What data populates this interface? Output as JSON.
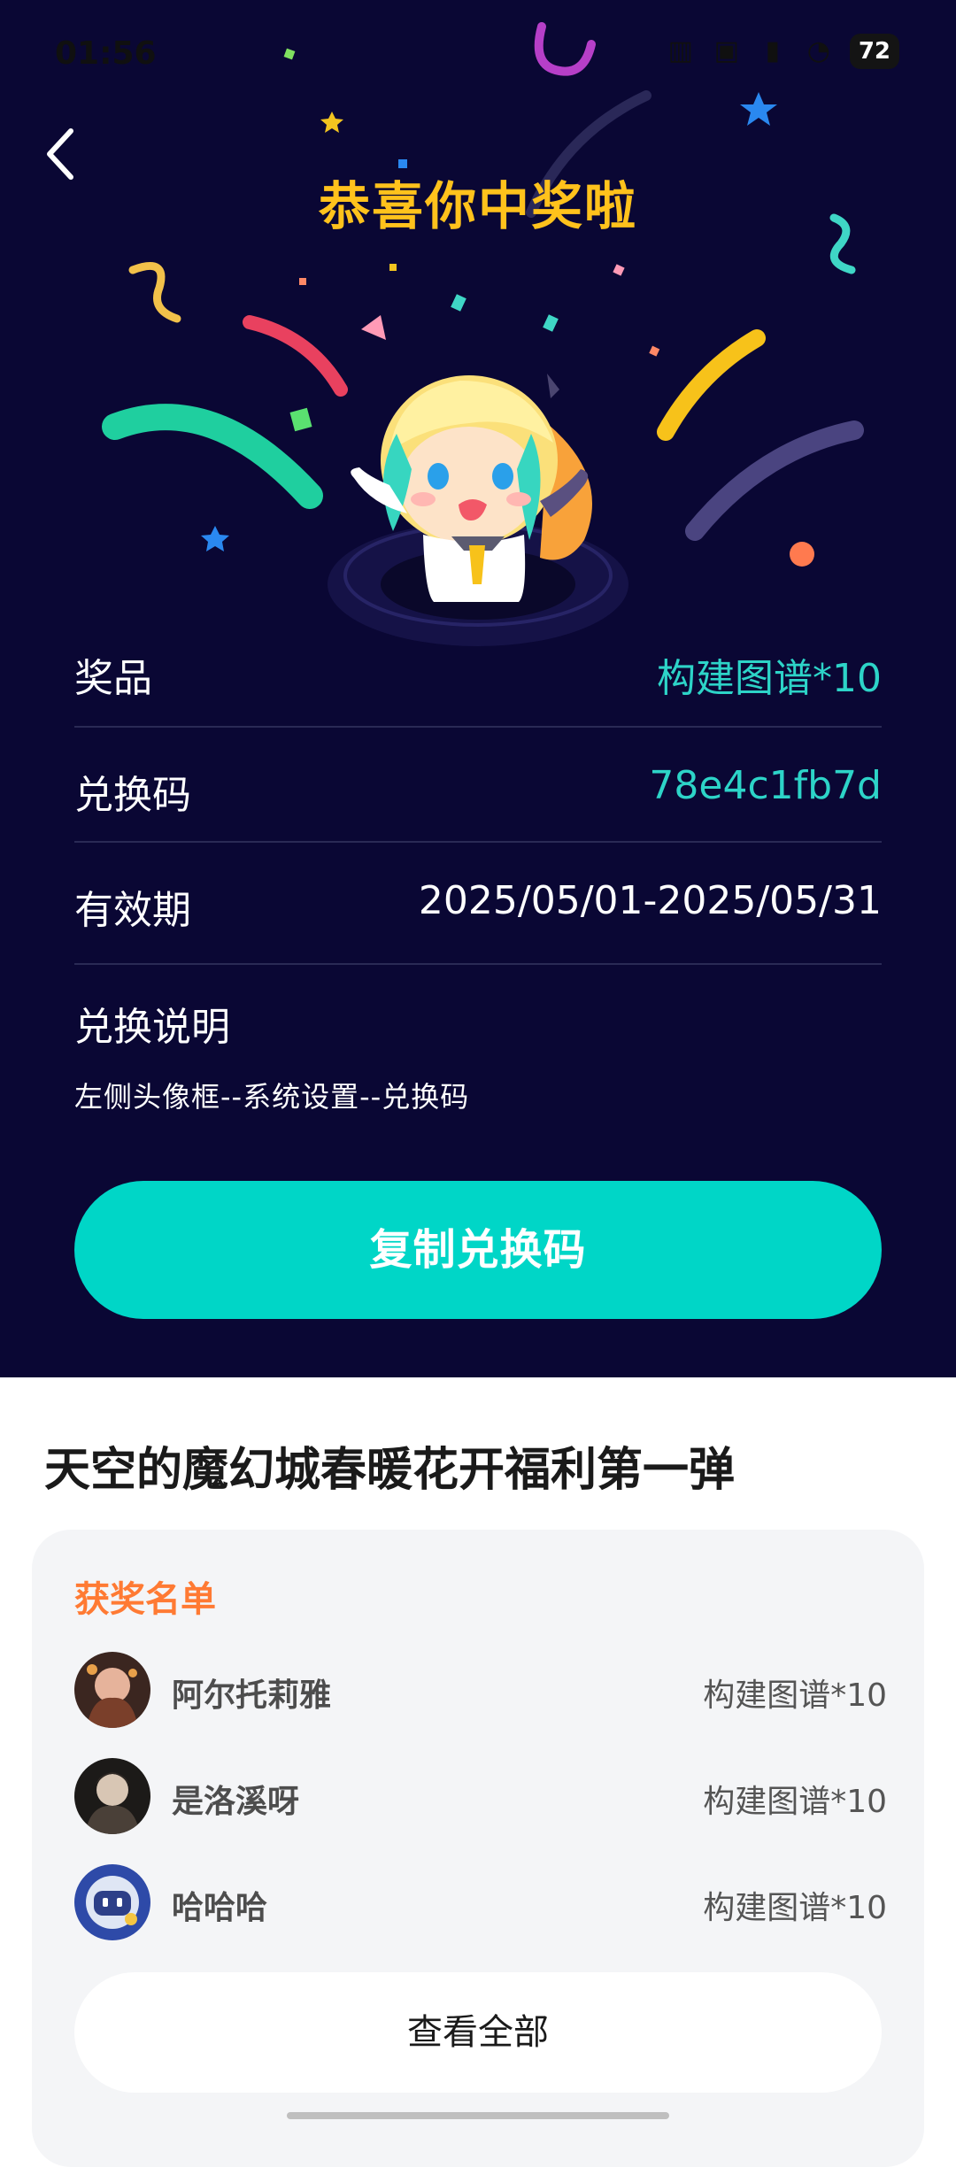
{
  "status_bar": {
    "time": "01:56",
    "battery": "72"
  },
  "header": {
    "title": "恭喜你中奖啦"
  },
  "prize_info": {
    "prize_label": "奖品",
    "prize_value": "构建图谱*10",
    "code_label": "兑换码",
    "code_value": "78e4c1fb7d",
    "validity_label": "有效期",
    "validity_value": "2025/05/01-2025/05/31",
    "instructions_label": "兑换说明",
    "instructions_text": "左侧头像框--系统设置--兑换码"
  },
  "actions": {
    "copy_code": "复制兑换码"
  },
  "event": {
    "title": "天空的魔幻城春暖花开福利第一弹"
  },
  "winners": {
    "title": "获奖名单",
    "list": [
      {
        "name": "阿尔托莉雅",
        "prize": "构建图谱*10"
      },
      {
        "name": "是洛溪呀",
        "prize": "构建图谱*10"
      },
      {
        "name": "哈哈哈",
        "prize": "构建图谱*10"
      }
    ],
    "view_all": "查看全部"
  },
  "colors": {
    "background_top": "#0a0734",
    "accent_cyan": "#00d6c7",
    "title_gold": "#ffc21c",
    "winners_orange": "#ff7a33"
  }
}
